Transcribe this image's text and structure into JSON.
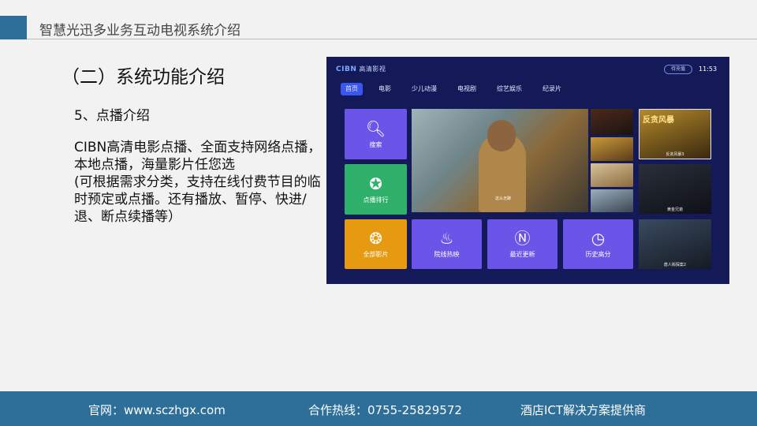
{
  "header": {
    "title": "智慧光迅多业务互动电视系统介绍"
  },
  "section": {
    "title": "（二）系统功能介绍",
    "subtitle": "5、点播介绍",
    "description": "CIBN高清电影点播、全面支持网络点播，本地点播，海量影片任您选\n(可根据需求分类，支持在线付费节目的临时预定或点播。还有播放、暂停、快进/退、断点续播等）"
  },
  "tv": {
    "logo": "CIBN",
    "logo_sub": "高清影视",
    "login": "待充值",
    "time": "11:53",
    "tabs": [
      "首页",
      "电影",
      "少儿动漫",
      "电视剧",
      "综艺娱乐",
      "纪录片"
    ],
    "tiles": {
      "search": "搜索",
      "rank": "点播排行",
      "all": "全部影片",
      "hot": "院线热映",
      "new": "最近更新",
      "high": "历史高分"
    },
    "hero_caption": "这么无聊",
    "posters": {
      "p5_title": "反贪风暴",
      "p5_caption": "反贪风暴3",
      "p6_caption": "黄金兄弟",
      "p7_caption": "唐人街探案2"
    }
  },
  "footer": {
    "website": "官网：www.sczhgx.com",
    "hotline": "合作热线：0755-25829572",
    "slogan": "酒店ICT解决方案提供商"
  }
}
